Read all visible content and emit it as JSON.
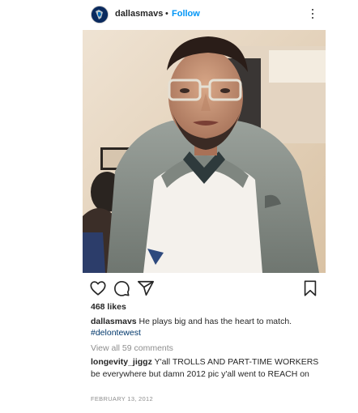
{
  "post": {
    "username": "dallasmavs",
    "separator": "•",
    "follow_label": "Follow",
    "more_icon": "more-vertical-icon",
    "image_alt": "man wearing glasses, gray hoodie and white apron",
    "likes": "468 likes",
    "caption_user": "dallasmavs",
    "caption_text": "He plays big and has the heart to match.",
    "hashtag": "#delontewest",
    "view_comments": "View all 59 comments",
    "comment_user": "longevity_jiggz",
    "comment_text": "Y'all TROLLS AND PART-TIME WORKERS be everywhere but damn 2012 pic y'all went to REACH on",
    "date": "FEBRUARY 13, 2012"
  },
  "icons": {
    "like": "heart-icon",
    "comment": "comment-icon",
    "share": "send-icon",
    "save": "bookmark-icon"
  },
  "colors": {
    "follow": "#0095f6",
    "hashtag": "#00376b",
    "muted": "#8e8e8e"
  }
}
